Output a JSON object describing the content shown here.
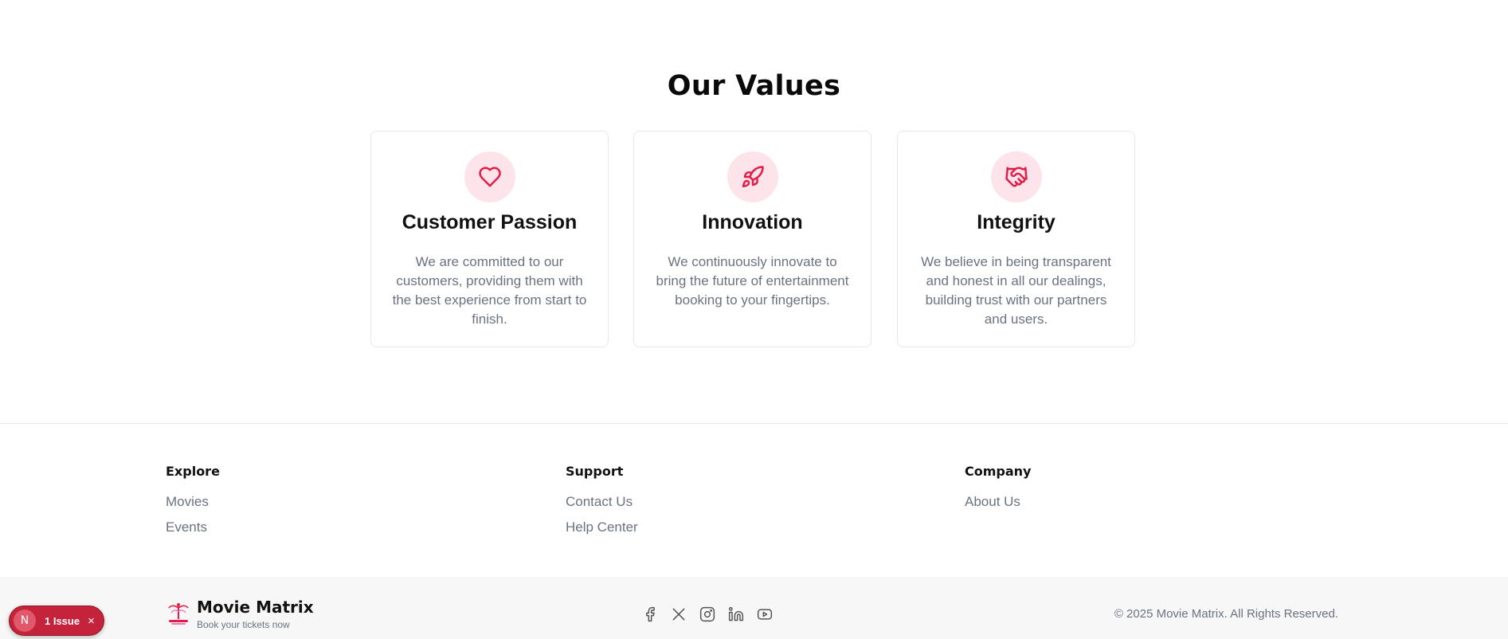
{
  "values": {
    "title": "Our Values",
    "cards": [
      {
        "icon": "heart-icon",
        "title": "Customer Passion",
        "text": "We are committed to our customers, providing them with the best experience from start to finish."
      },
      {
        "icon": "rocket-icon",
        "title": "Innovation",
        "text": "We continuously innovate to bring the future of entertainment booking to your fingertips."
      },
      {
        "icon": "handshake-icon",
        "title": "Integrity",
        "text": "We believe in being transparent and honest in all our dealings, building trust with our partners and users."
      }
    ]
  },
  "footer": {
    "columns": [
      {
        "heading": "Explore",
        "links": [
          "Movies",
          "Events"
        ]
      },
      {
        "heading": "Support",
        "links": [
          "Contact Us",
          "Help Center"
        ]
      },
      {
        "heading": "Company",
        "links": [
          "About Us"
        ]
      }
    ],
    "brand": {
      "name": "Movie Matrix",
      "tagline": "Book your tickets now"
    },
    "socials": [
      "facebook-icon",
      "x-icon",
      "instagram-icon",
      "linkedin-icon",
      "youtube-icon"
    ],
    "copyright": "© 2025 Movie Matrix. All Rights Reserved."
  },
  "dev_badge": {
    "letter": "N",
    "label": "1 Issue",
    "close": "×"
  },
  "colors": {
    "accent": "#e11d48",
    "accent_bg": "#fde4ea",
    "muted": "#6b7280"
  }
}
